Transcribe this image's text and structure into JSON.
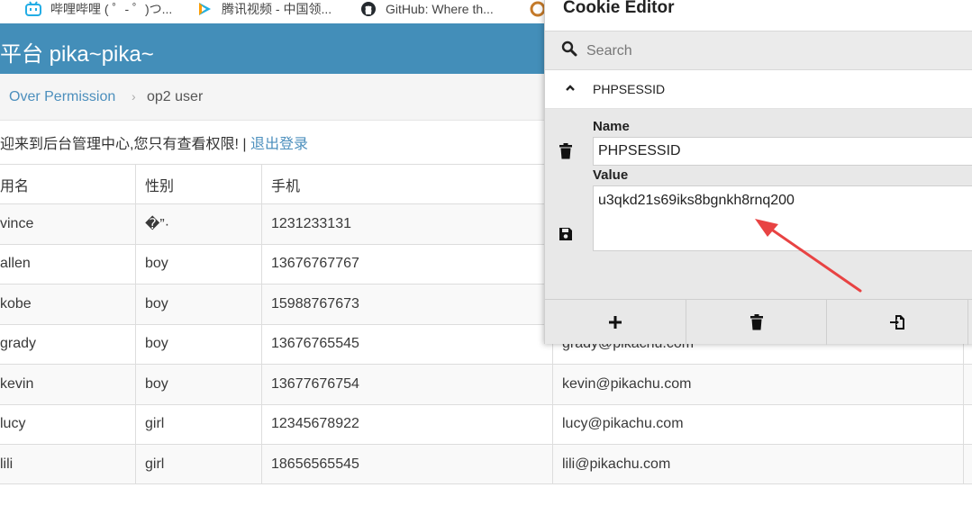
{
  "bookmarks": [
    {
      "label": "哔哩哔哩 ( ゜- ゜)つ...",
      "icon": "bilibili-icon"
    },
    {
      "label": "腾讯视频 - 中国领...",
      "icon": "tencent-video-icon"
    },
    {
      "label": "GitHub: Where th...",
      "icon": "github-icon"
    },
    {
      "label": "",
      "icon": "site-icon"
    }
  ],
  "site": {
    "title": "平台 pika~pika~",
    "header_color": "#438eb9"
  },
  "breadcrumb": {
    "item1": "Over Permission",
    "separator": "›",
    "item2": "op2 user"
  },
  "welcome": {
    "text": "迎来到后台管理中心,您只有查看权限! | ",
    "logout": "退出登录"
  },
  "table": {
    "headers": [
      "用名",
      "性别",
      "手机",
      "",
      ""
    ],
    "rows": [
      [
        "vince",
        "�”·",
        "1231233131",
        "",
        ""
      ],
      [
        "allen",
        "boy",
        "13676767767",
        "",
        ""
      ],
      [
        "kobe",
        "boy",
        "15988767673",
        "",
        ""
      ],
      [
        "grady",
        "boy",
        "13676765545",
        "grady@pikachu.com",
        ""
      ],
      [
        "kevin",
        "boy",
        "13677676754",
        "kevin@pikachu.com",
        ""
      ],
      [
        "lucy",
        "girl",
        "12345678922",
        "lucy@pikachu.com",
        ""
      ],
      [
        "lili",
        "girl",
        "18656565545",
        "lili@pikachu.com",
        ""
      ]
    ]
  },
  "cookie_editor": {
    "title": "Cookie Editor",
    "search_placeholder": "Search",
    "cookie_name": "PHPSESSID",
    "name_label": "Name",
    "name_value": "PHPSESSID",
    "value_label": "Value",
    "value_value": "u3qkd21s69iks8bgnkh8rnq200",
    "toolbar": [
      {
        "icon": "plus-icon",
        "label": "Add cookie"
      },
      {
        "icon": "trash-icon",
        "label": "Delete all"
      },
      {
        "icon": "import-icon",
        "label": "Import"
      }
    ]
  },
  "annotation_color": "#e84343"
}
